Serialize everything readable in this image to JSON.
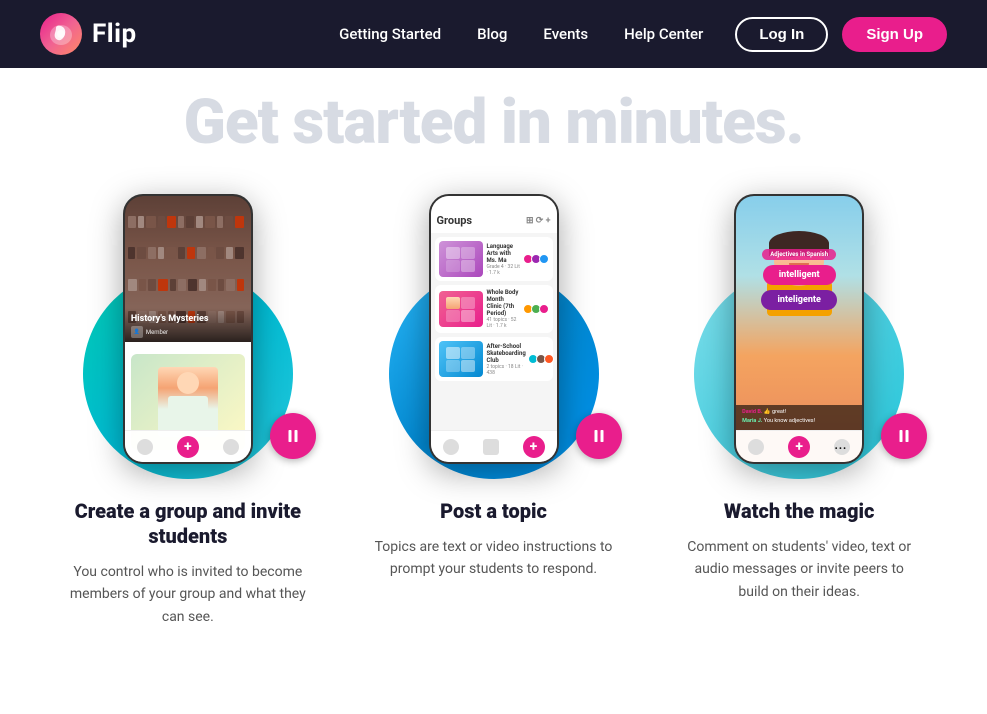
{
  "nav": {
    "logo_text": "Flip",
    "links": [
      {
        "label": "Getting Started",
        "id": "getting-started"
      },
      {
        "label": "Blog",
        "id": "blog"
      },
      {
        "label": "Events",
        "id": "events"
      },
      {
        "label": "Help Center",
        "id": "help-center"
      }
    ],
    "login_label": "Log In",
    "signup_label": "Sign Up"
  },
  "hero": {
    "heading": "Get started in minutes."
  },
  "cards": [
    {
      "id": "card-1",
      "title": "Create a group and invite students",
      "description": "You control who is invited to become members of your group and what they can see.",
      "phone_label": "History's Mysteries",
      "phone_sublabel": "Member"
    },
    {
      "id": "card-2",
      "title": "Post a topic",
      "description": "Topics are text or video instructions to prompt your students to respond.",
      "phone_label": "Groups"
    },
    {
      "id": "card-3",
      "title": "Watch the magic",
      "description": "Comment on students' video, text or audio messages or invite peers to build on their ideas.",
      "vocab_label": "Adjectives in Spanish",
      "vocab_word_1": "intelligent",
      "vocab_word_2": "inteligente"
    }
  ],
  "pause_icon": "⏸"
}
